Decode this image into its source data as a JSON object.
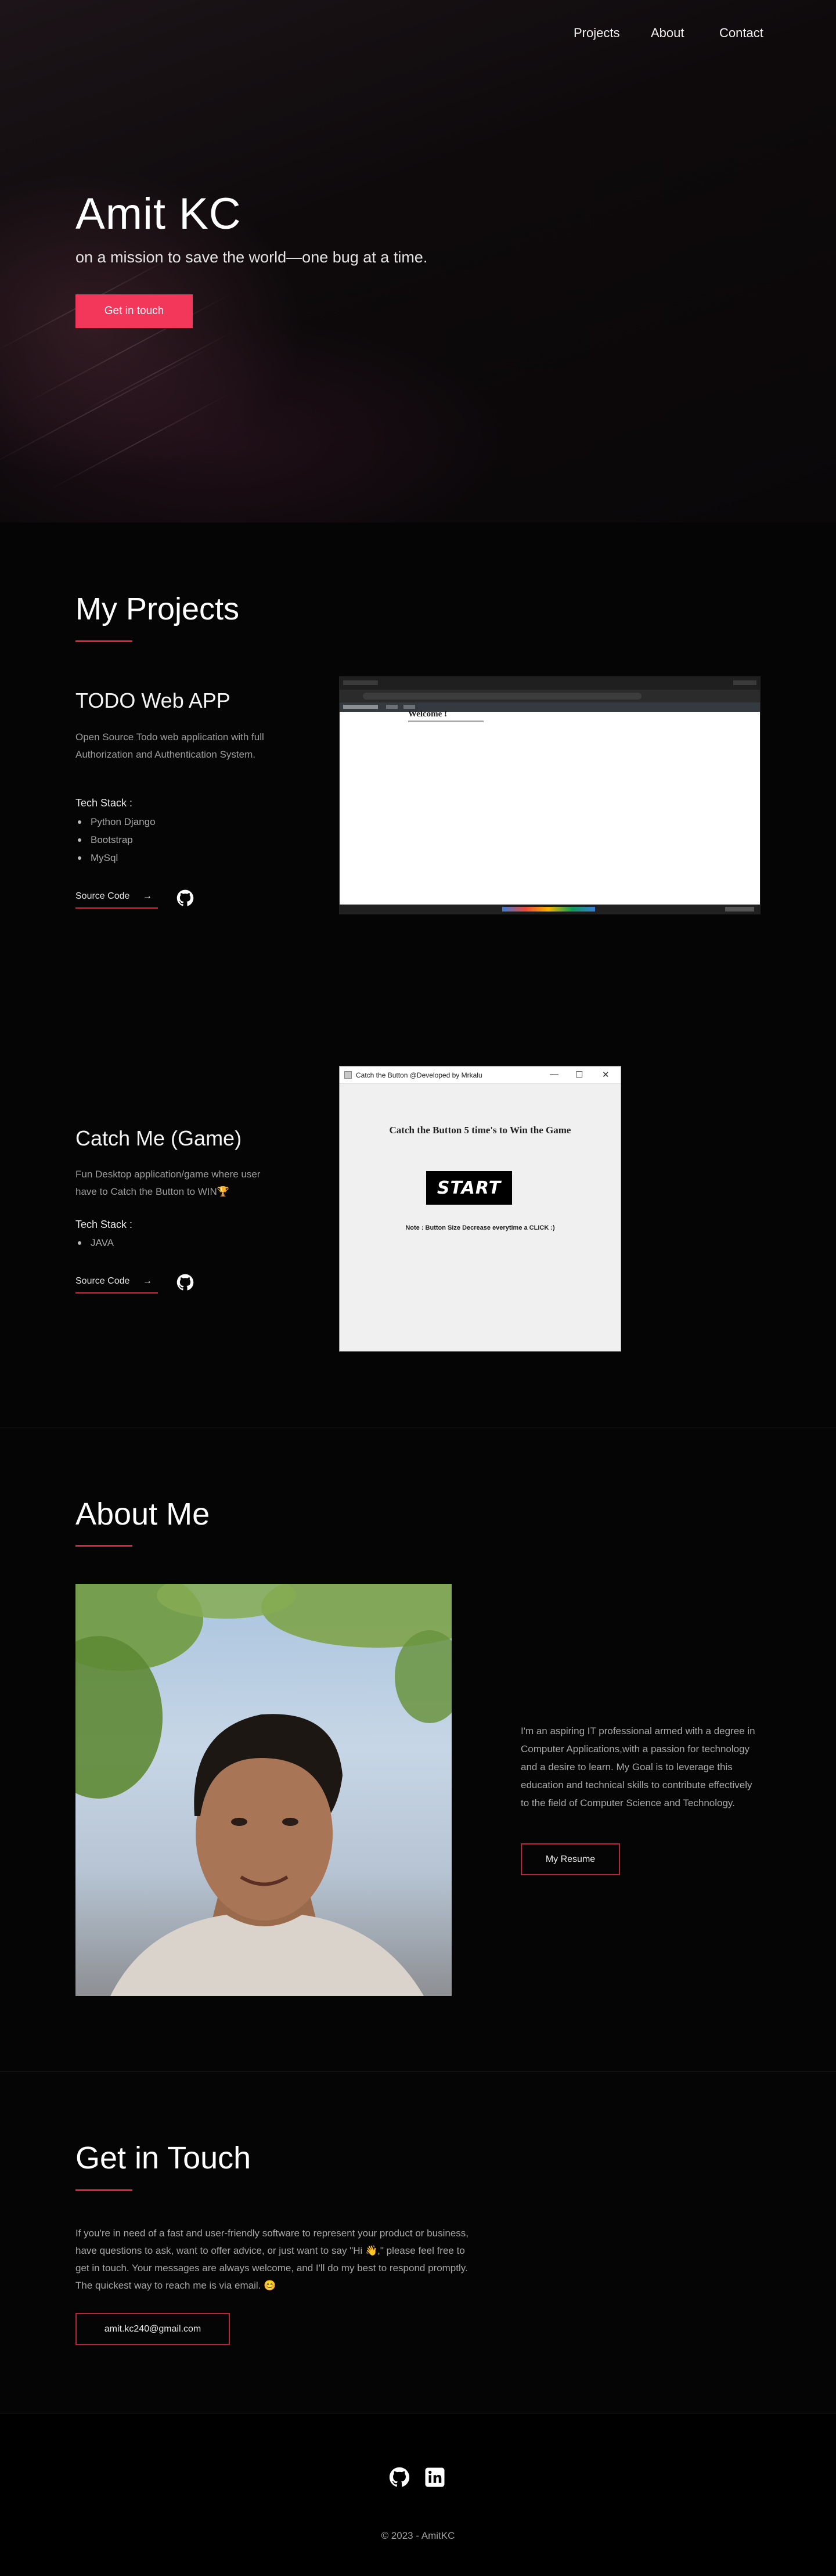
{
  "nav": {
    "projects": "Projects",
    "about": "About",
    "contact": "Contact"
  },
  "hero": {
    "name": "Amit KC",
    "tagline": "on a mission to save the world—one bug at a time.",
    "cta": "Get in touch"
  },
  "projects": {
    "heading": "My Projects",
    "items": [
      {
        "title": "TODO Web APP",
        "description": "Open Source Todo web application with full Authorization and Authentication System.",
        "stack_label": "Tech Stack :",
        "stack": [
          "Python Django",
          "Bootstrap",
          "MySql"
        ],
        "source_label": "Source Code",
        "screenshot": {
          "welcome": "Welcome !"
        }
      },
      {
        "title": "Catch Me (Game)",
        "description": "Fun Desktop application/game where user have to Catch the Button to WIN🏆",
        "stack_label": "Tech Stack :",
        "stack": [
          "JAVA"
        ],
        "source_label": "Source Code",
        "screenshot": {
          "window_title": "Catch the Button @Developed by Mrkalu",
          "heading": "Catch the Button 5 time's to Win the Game",
          "button": "START",
          "note": "Note : Button Size Decrease everytime a CLICK :)"
        }
      }
    ]
  },
  "about": {
    "heading": "About Me",
    "text": "I'm an aspiring IT professional armed with a degree in Computer Applications,with a passion for technology and a desire to learn. My Goal is to leverage this education and technical skills to contribute effectively to the field of Computer Science and Technology.",
    "resume": "My Resume"
  },
  "contact": {
    "heading": "Get in Touch",
    "text": "If you're in need of a fast and user-friendly software to represent your product or business, have questions to ask, want to offer advice, or just want to say \"Hi 👋,\" please feel free to get in touch. Your messages are always welcome, and I'll do my best to respond promptly. The quickest way to reach me is via email. 😊",
    "email": "amit.kc240@gmail.com"
  },
  "footer": {
    "copyright": "© 2023 - AmitKC"
  },
  "icons": {
    "github": "github-icon",
    "linkedin": "linkedin-icon"
  },
  "colors": {
    "accent": "#f2375a",
    "underline": "#d9283e",
    "background": "#050505"
  }
}
